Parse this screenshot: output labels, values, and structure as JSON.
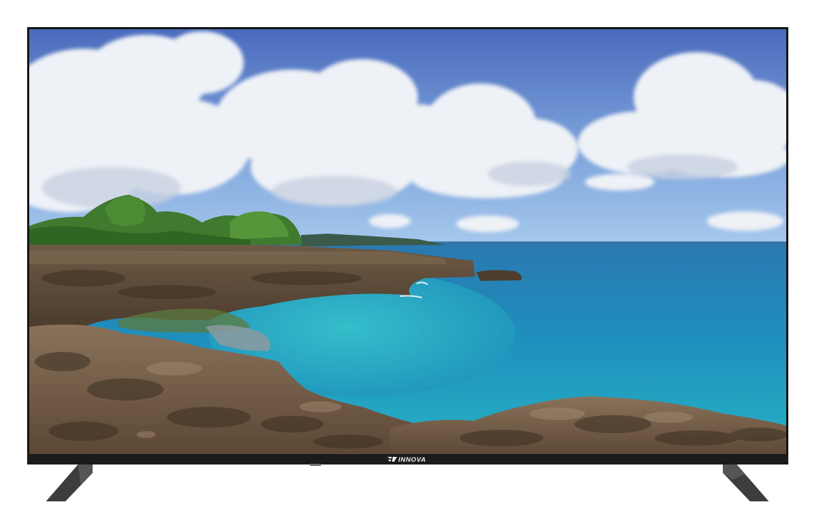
{
  "product": {
    "brand_name": "INNOVA",
    "brand_icon": "innova-wing-logo-icon",
    "screen_scene": "ocean-cliff-coastline-image"
  },
  "colors": {
    "bezel": "#121212",
    "bottom_bar": "#1b1b1b",
    "stand": "#3f3f3f",
    "sky_top": "#4d6fc0",
    "sky_horizon": "#9dc0ea",
    "sea_deep": "#1c7fb4",
    "sea_shallow": "#2fb4c3",
    "rock": "#5e4a36"
  }
}
